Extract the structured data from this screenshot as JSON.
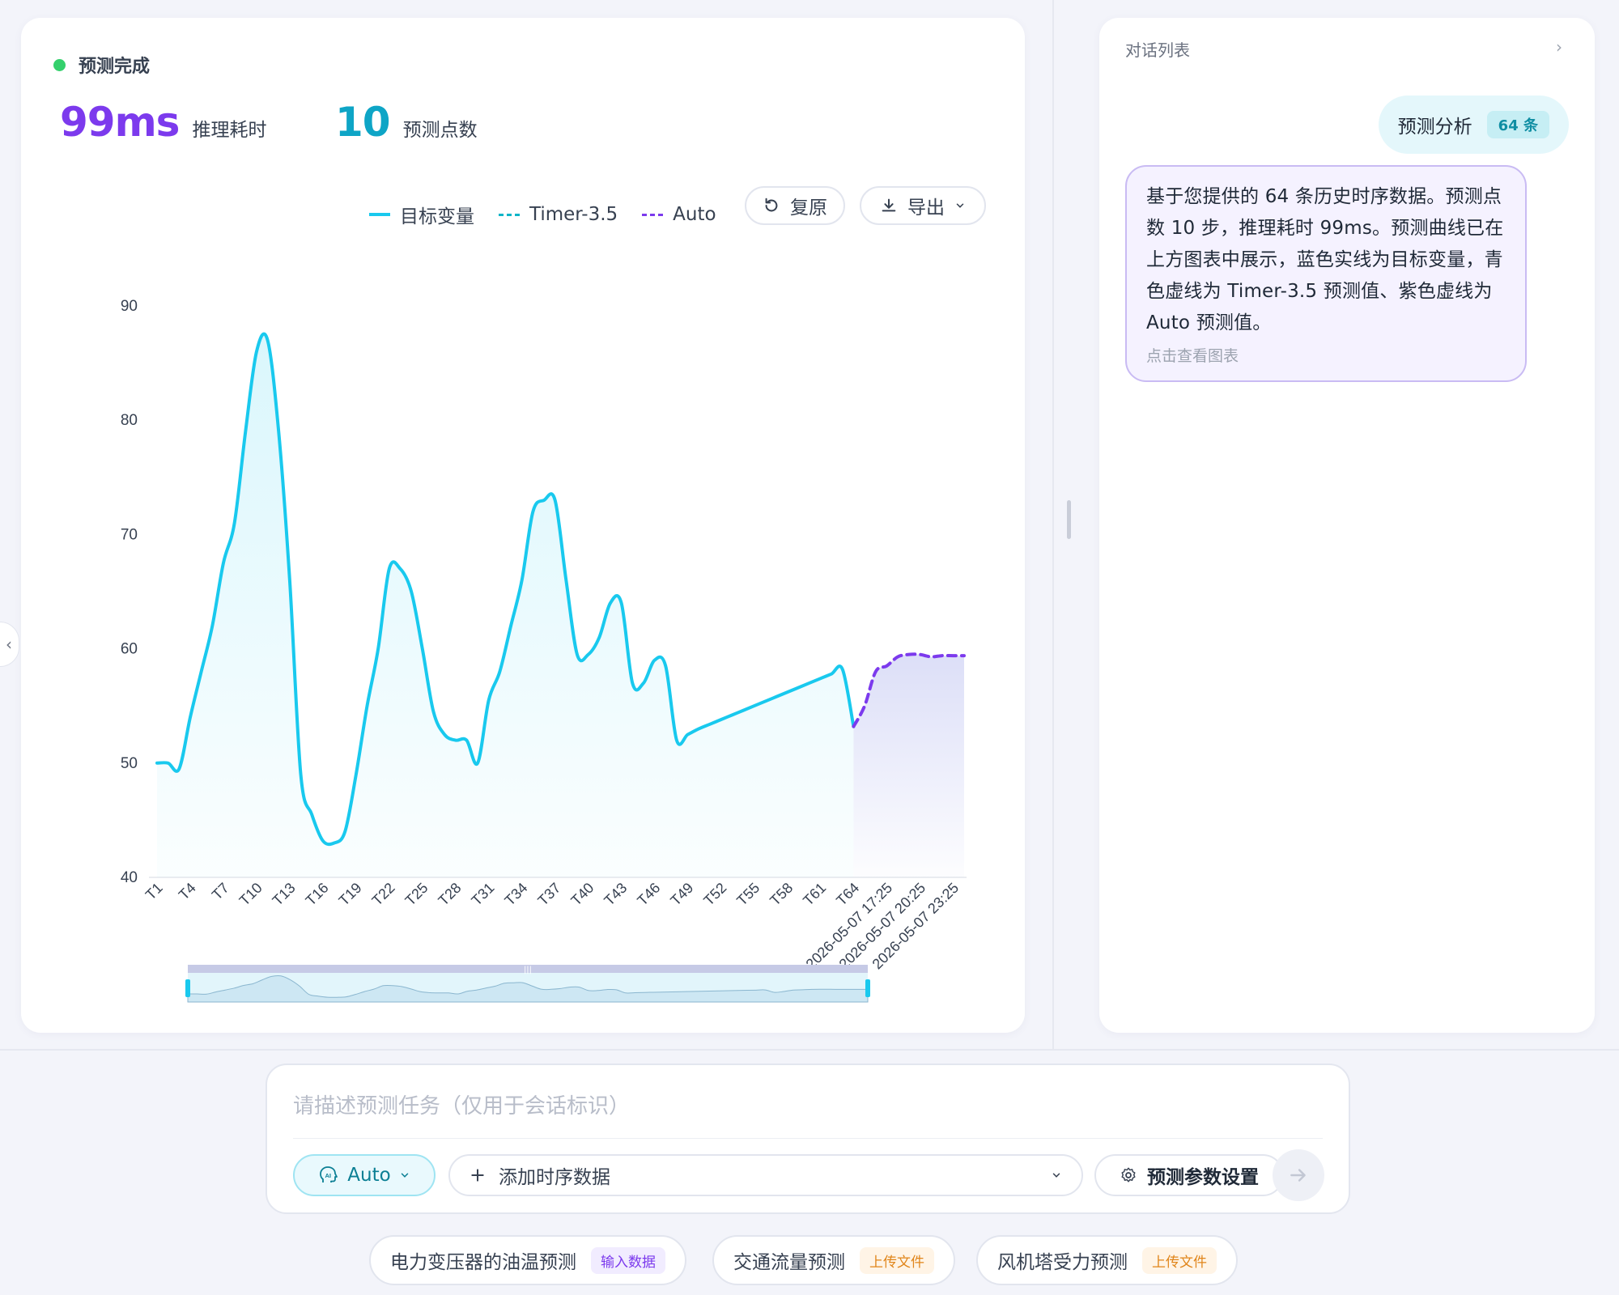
{
  "status": {
    "label": "预测完成",
    "color": "#34d06c"
  },
  "metrics": [
    {
      "value": "99ms",
      "label": "推理耗时",
      "color": "#7c3aed"
    },
    {
      "value": "10",
      "label": "预测点数",
      "color": "#0ea5c6"
    }
  ],
  "legend": [
    {
      "name": "目标变量",
      "color": "#19c9ee",
      "style": "solid"
    },
    {
      "name": "Timer-3.5",
      "color": "#0fb5c8",
      "style": "dashed"
    },
    {
      "name": "Auto",
      "color": "#7c3aed",
      "style": "dashed"
    }
  ],
  "toolbar": {
    "reset_label": "复原",
    "export_label": "导出"
  },
  "chart_data": {
    "type": "line",
    "ylim": [
      40,
      90
    ],
    "y_ticks": [
      40,
      50,
      60,
      70,
      80,
      90
    ],
    "x_tick_labels": [
      "T1",
      "T4",
      "T7",
      "T10",
      "T13",
      "T16",
      "T19",
      "T22",
      "T25",
      "T28",
      "T31",
      "T34",
      "T37",
      "T40",
      "T43",
      "T46",
      "T49",
      "T52",
      "T55",
      "T58",
      "T61",
      "T64",
      "2026-05-07 17:25",
      "2026-05-07 20:25",
      "2026-05-07 23:25"
    ],
    "series": [
      {
        "name": "目标变量",
        "x": [
          "T1",
          "T2",
          "T3",
          "T4",
          "T5",
          "T6",
          "T7",
          "T8",
          "T9",
          "T10",
          "T11",
          "T12",
          "T13",
          "T14",
          "T15",
          "T16",
          "T17",
          "T18",
          "T19",
          "T20",
          "T21",
          "T22",
          "T23",
          "T24",
          "T25",
          "T26",
          "T27",
          "T28",
          "T29",
          "T30",
          "T31",
          "T32",
          "T33",
          "T34",
          "T35",
          "T36",
          "T37",
          "T38",
          "T39",
          "T40",
          "T41",
          "T42",
          "T43",
          "T44",
          "T45",
          "T46",
          "T47",
          "T48",
          "T49",
          "T50",
          "T51",
          "T52",
          "T53",
          "T54",
          "T55",
          "T56",
          "T57",
          "T58",
          "T59",
          "T60",
          "T61",
          "T62",
          "T63",
          "T64"
        ],
        "values": [
          50,
          50,
          49.5,
          54,
          58,
          62,
          67.5,
          71,
          79,
          86,
          87,
          79,
          66,
          49,
          45.5,
          43.2,
          43,
          44,
          49,
          55,
          60,
          67,
          67,
          65,
          60,
          54.5,
          52.5,
          52,
          52,
          50,
          55.5,
          58,
          62,
          66,
          72,
          73,
          73,
          66,
          59.5,
          59.5,
          61,
          64,
          64,
          57,
          57,
          59,
          58.5,
          52,
          52.5,
          53,
          53.4,
          53.8,
          54.2,
          54.6,
          55,
          55.4,
          55.8,
          56.2,
          56.6,
          57,
          57.4,
          57.8,
          58.2,
          53.2
        ]
      },
      {
        "name": "Auto",
        "x": [
          "T64",
          "2026-05-07 17:25",
          "2026-05-07 18:25",
          "2026-05-07 19:25",
          "2026-05-07 20:25",
          "2026-05-07 21:25",
          "2026-05-07 22:25",
          "2026-05-07 23:25",
          "2026-05-08 00:25",
          "2026-05-08 01:25",
          "2026-05-08 02:25"
        ],
        "values": [
          53.2,
          55,
          58,
          58.5,
          59.3,
          59.5,
          59.5,
          59.3,
          59.4,
          59.4,
          59.4
        ]
      }
    ]
  },
  "right_panel": {
    "title": "对话列表",
    "user_message": "预测分析",
    "user_badge": "64 条",
    "ai_message": "基于您提供的 64 条历史时序数据。预测点数 10 步，推理耗时 99ms。预测曲线已在上方图表中展示，蓝色实线为目标变量，青色虚线为 Timer-3.5 预测值、紫色虚线为 Auto 预测值。",
    "ai_link": "点击查看图表"
  },
  "composer": {
    "placeholder": "请描述预测任务（仅用于会话标识）",
    "model_label": "Auto",
    "add_data_label": "添加时序数据",
    "param_label": "预测参数设置"
  },
  "suggestions": [
    {
      "label": "电力变压器的油温预测",
      "tag": "输入数据",
      "tag_color": "#7c3aed"
    },
    {
      "label": "交通流量预测",
      "tag": "上传文件",
      "tag_color": "#e0851a"
    },
    {
      "label": "风机塔受力预测",
      "tag": "上传文件",
      "tag_color": "#e0851a"
    }
  ]
}
